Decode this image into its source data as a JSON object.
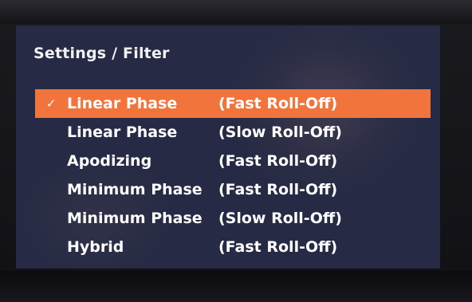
{
  "header": {
    "title": "Settings / Filter"
  },
  "menu": {
    "items": [
      {
        "check": "✓",
        "name": "Linear Phase",
        "param": "(Fast Roll-Off)",
        "selected": true
      },
      {
        "check": "",
        "name": "Linear Phase",
        "param": "(Slow Roll-Off)",
        "selected": false
      },
      {
        "check": "",
        "name": "Apodizing",
        "param": "(Fast Roll-Off)",
        "selected": false
      },
      {
        "check": "",
        "name": "Minimum Phase",
        "param": "(Fast Roll-Off)",
        "selected": false
      },
      {
        "check": "",
        "name": "Minimum Phase",
        "param": "(Slow Roll-Off)",
        "selected": false
      },
      {
        "check": "",
        "name": "Hybrid",
        "param": "(Fast Roll-Off)",
        "selected": false
      }
    ]
  },
  "colors": {
    "screen_bg": "#262a44",
    "selection": "#f0743c",
    "text": "#ffffff"
  }
}
